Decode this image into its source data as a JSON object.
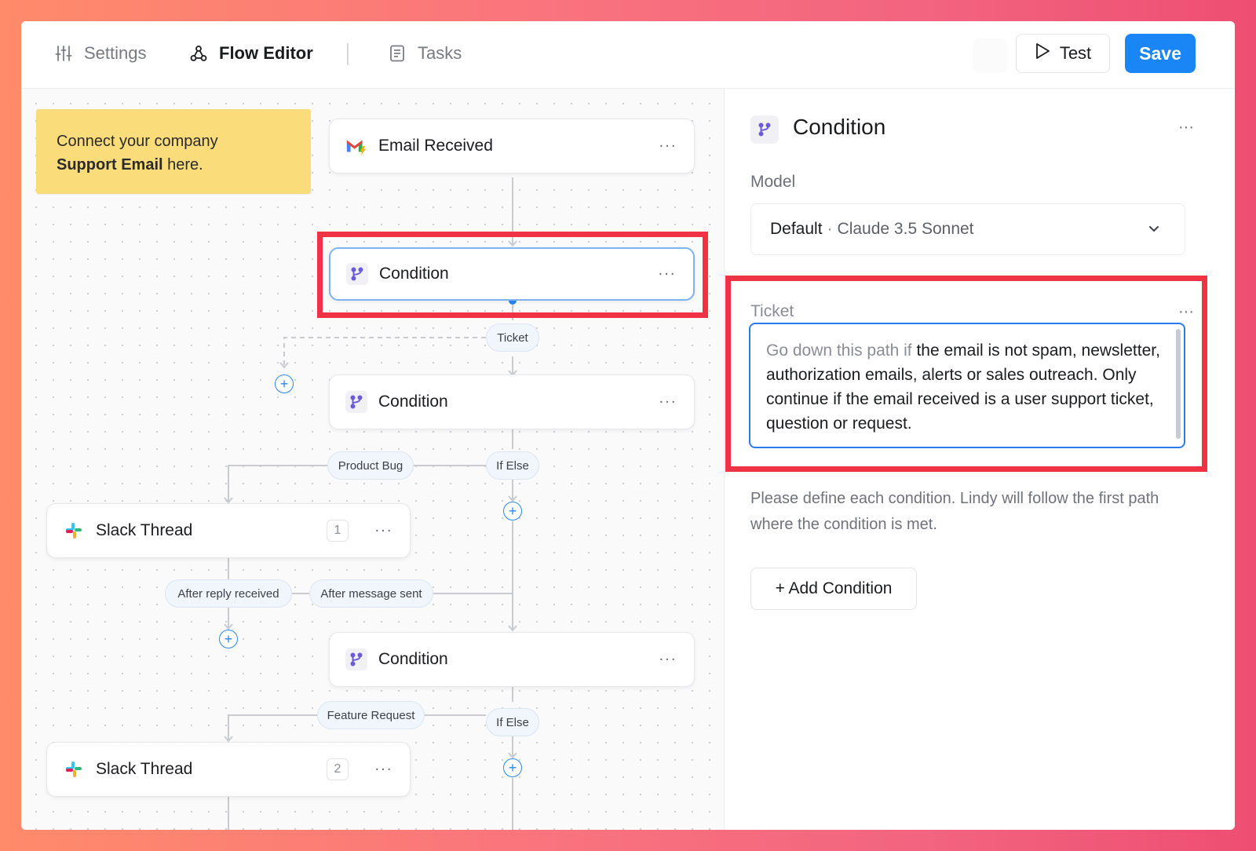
{
  "topbar": {
    "tabs": [
      {
        "label": "Settings",
        "icon": "sliders-icon"
      },
      {
        "label": "Flow Editor",
        "icon": "flow-icon"
      },
      {
        "label": "Tasks",
        "icon": "document-icon"
      }
    ],
    "test_label": "Test",
    "save_label": "Save"
  },
  "canvas": {
    "sticky_note": {
      "line1": "Connect your company",
      "bold": "Support Email",
      "tail": " here."
    },
    "nodes": [
      {
        "title": "Email Received",
        "icon": "gmail-icon"
      },
      {
        "title": "Condition",
        "icon": "condition-icon"
      },
      {
        "title": "Condition",
        "icon": "condition-icon"
      },
      {
        "title": "Slack Thread",
        "icon": "slack-icon",
        "badge": "1"
      },
      {
        "title": "Condition",
        "icon": "condition-icon"
      },
      {
        "title": "Slack Thread",
        "icon": "slack-icon",
        "badge": "2"
      }
    ],
    "pills": [
      "Ticket",
      "Product Bug",
      "If Else",
      "After reply received",
      "After message sent",
      "Feature Request",
      "If Else"
    ],
    "menu_glyph": "···"
  },
  "panel": {
    "title": "Condition",
    "model_label": "Model",
    "model_default": "Default",
    "model_sep": "·",
    "model_name": "Claude 3.5 Sonnet",
    "ticket_label": "Ticket",
    "ticket_prefix": "Go down this path if",
    "ticket_text": " the email is not spam, newsletter, authorization emails, alerts or sales outreach. Only continue if the email received is a user support ticket, question or request.",
    "hint": "Please define each condition. Lindy will follow the first path where the condition is met.",
    "add_condition_label": "+ Add Condition",
    "menu_glyph": "···"
  },
  "colors": {
    "accent": "#1a86f5",
    "highlight": "#ef3344",
    "sticky": "#fbdc7a"
  }
}
